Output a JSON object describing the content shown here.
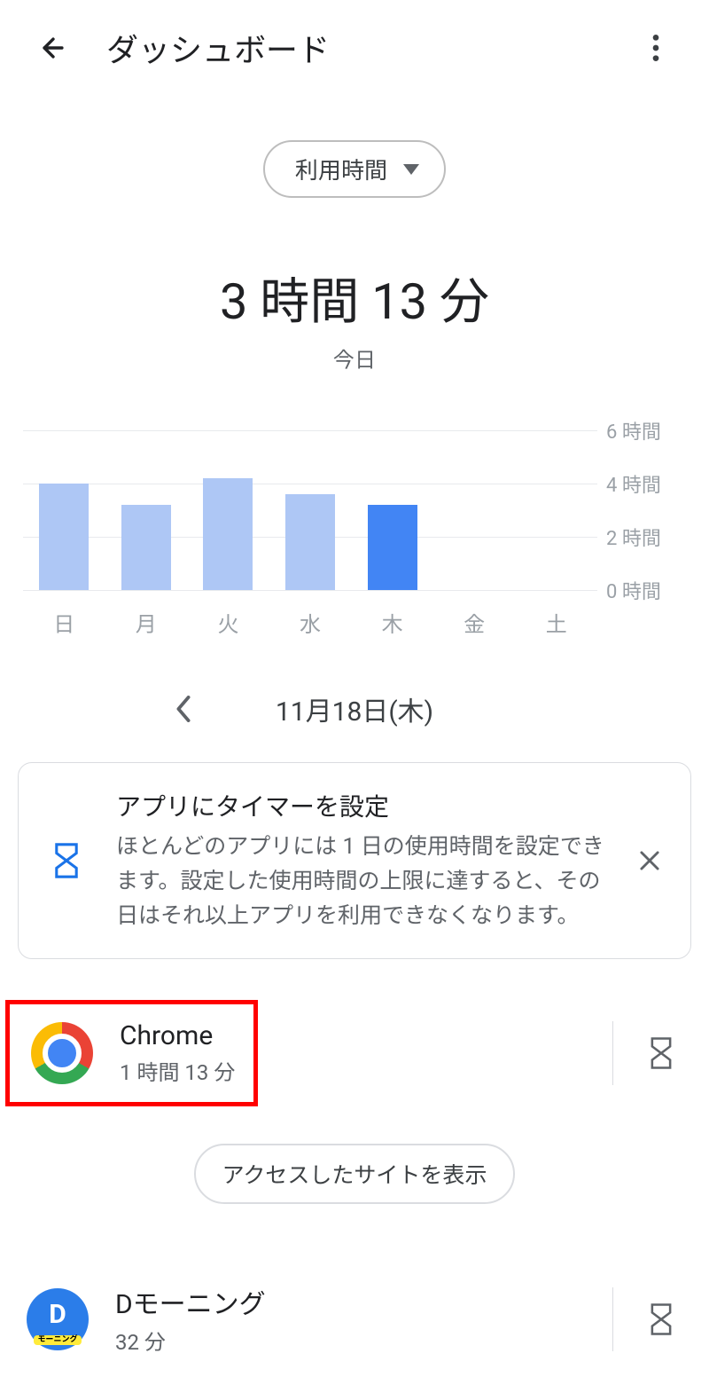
{
  "header": {
    "title": "ダッシュボード"
  },
  "metricSelector": {
    "label": "利用時間"
  },
  "summary": {
    "total": "3 時間 13 分",
    "todayLabel": "今日"
  },
  "chart_data": {
    "type": "bar",
    "categories": [
      "日",
      "月",
      "火",
      "水",
      "木",
      "金",
      "土"
    ],
    "values": [
      4.0,
      3.2,
      4.2,
      3.6,
      3.2,
      0,
      0
    ],
    "highlight_index": 4,
    "ylim": [
      0,
      6
    ],
    "y_unit_suffix": " 時間",
    "y_ticks": [
      0,
      2,
      4,
      6
    ]
  },
  "dateNav": {
    "dateLabel": "11月18日(木)"
  },
  "infoCard": {
    "title": "アプリにタイマーを設定",
    "description": "ほとんどのアプリには 1 日の使用時間を設定できます。設定した使用時間の上限に達すると、その日はそれ以上アプリを利用できなくなります。"
  },
  "apps": [
    {
      "name": "Chrome",
      "time": "1 時間 13 分",
      "icon": "chrome"
    },
    {
      "name": "Dモーニング",
      "time": "32 分",
      "icon": "dmorning"
    }
  ],
  "sitesButton": {
    "label": "アクセスしたサイトを表示"
  },
  "icons": {
    "hourglass_color": "#1a73e8",
    "hourglass_grey": "#5f6368"
  }
}
